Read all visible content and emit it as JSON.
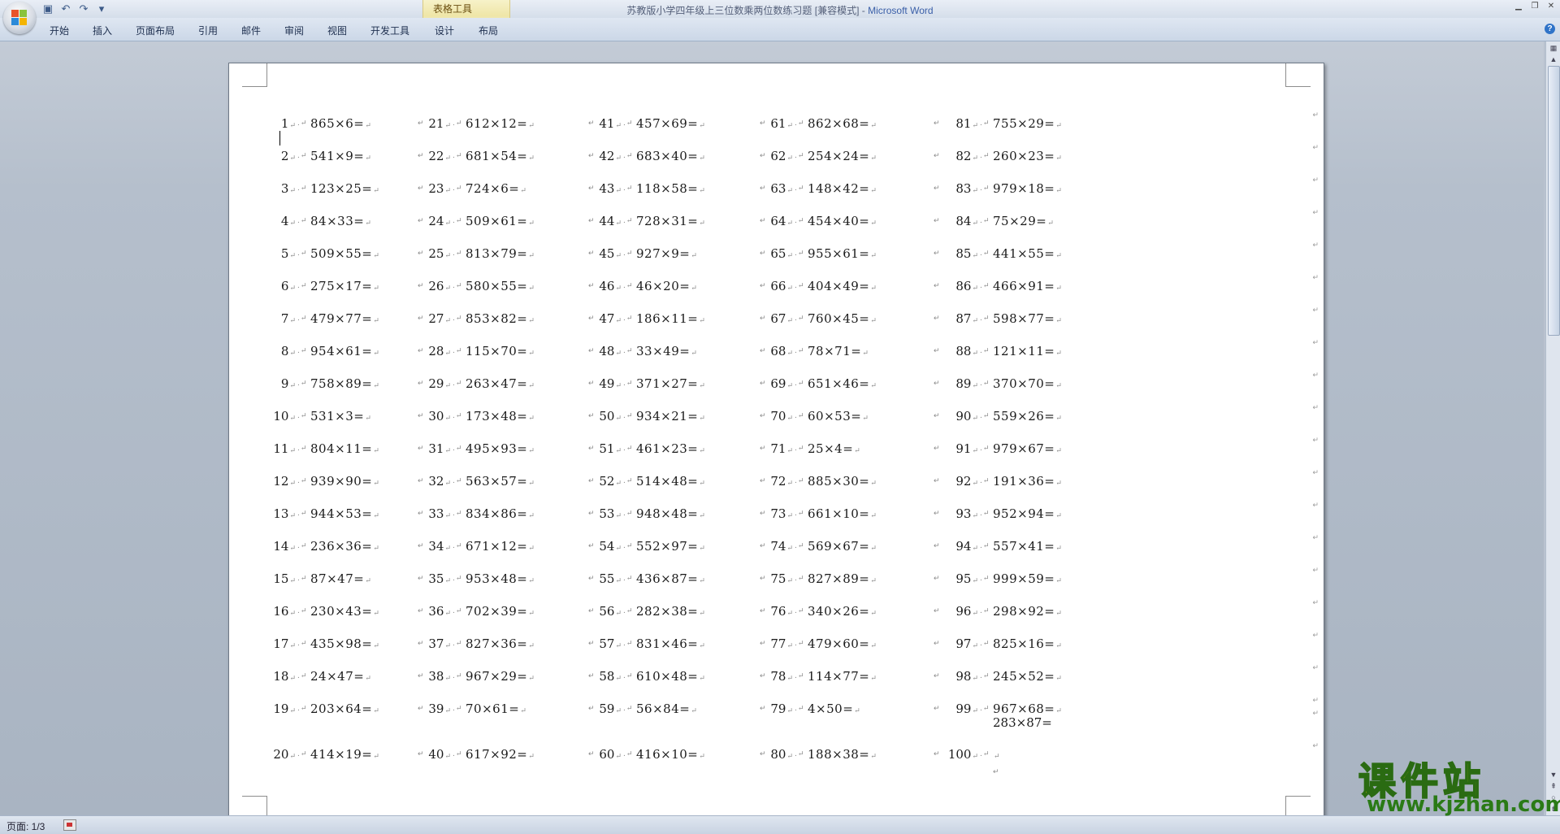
{
  "window": {
    "title": "苏教版小学四年级上三位数乘两位数练习题 [兼容模式] - ",
    "app_name": "Microsoft Word",
    "contextual_group": "表格工具"
  },
  "ribbon_tabs": [
    "开始",
    "插入",
    "页面布局",
    "引用",
    "邮件",
    "审阅",
    "视图",
    "开发工具",
    "设计",
    "布局"
  ],
  "status_bar": {
    "page": "页面: 1/3"
  },
  "watermark": {
    "main": "课件站",
    "sub": "www.kjzhan.com"
  },
  "document": {
    "columns": [
      [
        [
          "1",
          "865×6="
        ],
        [
          "2",
          "541×9="
        ],
        [
          "3",
          "123×25="
        ],
        [
          "4",
          "84×33="
        ],
        [
          "5",
          "509×55="
        ],
        [
          "6",
          "275×17="
        ],
        [
          "7",
          "479×77="
        ],
        [
          "8",
          "954×61="
        ],
        [
          "9",
          "758×89="
        ],
        [
          "10",
          "531×3="
        ],
        [
          "11",
          "804×11="
        ],
        [
          "12",
          "939×90="
        ],
        [
          "13",
          "944×53="
        ],
        [
          "14",
          "236×36="
        ],
        [
          "15",
          "87×47="
        ],
        [
          "16",
          "230×43="
        ],
        [
          "17",
          "435×98="
        ],
        [
          "18",
          "24×47="
        ],
        [
          "19",
          "203×64="
        ],
        [
          "20",
          "414×19="
        ]
      ],
      [
        [
          "21",
          "612×12="
        ],
        [
          "22",
          "681×54="
        ],
        [
          "23",
          "724×6="
        ],
        [
          "24",
          "509×61="
        ],
        [
          "25",
          "813×79="
        ],
        [
          "26",
          "580×55="
        ],
        [
          "27",
          "853×82="
        ],
        [
          "28",
          "115×70="
        ],
        [
          "29",
          "263×47="
        ],
        [
          "30",
          "173×48="
        ],
        [
          "31",
          "495×93="
        ],
        [
          "32",
          "563×57="
        ],
        [
          "33",
          "834×86="
        ],
        [
          "34",
          "671×12="
        ],
        [
          "35",
          "953×48="
        ],
        [
          "36",
          "702×39="
        ],
        [
          "37",
          "827×36="
        ],
        [
          "38",
          "967×29="
        ],
        [
          "39",
          "70×61="
        ],
        [
          "40",
          "617×92="
        ]
      ],
      [
        [
          "41",
          "457×69="
        ],
        [
          "42",
          "683×40="
        ],
        [
          "43",
          "118×58="
        ],
        [
          "44",
          "728×31="
        ],
        [
          "45",
          "927×9="
        ],
        [
          "46",
          "46×20="
        ],
        [
          "47",
          "186×11="
        ],
        [
          "48",
          "33×49="
        ],
        [
          "49",
          "371×27="
        ],
        [
          "50",
          "934×21="
        ],
        [
          "51",
          "461×23="
        ],
        [
          "52",
          "514×48="
        ],
        [
          "53",
          "948×48="
        ],
        [
          "54",
          "552×97="
        ],
        [
          "55",
          "436×87="
        ],
        [
          "56",
          "282×38="
        ],
        [
          "57",
          "831×46="
        ],
        [
          "58",
          "610×48="
        ],
        [
          "59",
          "56×84="
        ],
        [
          "60",
          "416×10="
        ]
      ],
      [
        [
          "61",
          "862×68="
        ],
        [
          "62",
          "254×24="
        ],
        [
          "63",
          "148×42="
        ],
        [
          "64",
          "454×40="
        ],
        [
          "65",
          "955×61="
        ],
        [
          "66",
          "404×49="
        ],
        [
          "67",
          "760×45="
        ],
        [
          "68",
          "78×71="
        ],
        [
          "69",
          "651×46="
        ],
        [
          "70",
          "60×53="
        ],
        [
          "71",
          "25×4="
        ],
        [
          "72",
          "885×30="
        ],
        [
          "73",
          "661×10="
        ],
        [
          "74",
          "569×67="
        ],
        [
          "75",
          "827×89="
        ],
        [
          "76",
          "340×26="
        ],
        [
          "77",
          "479×60="
        ],
        [
          "78",
          "114×77="
        ],
        [
          "79",
          "4×50="
        ],
        [
          "80",
          "188×38="
        ]
      ],
      [
        [
          "81",
          "755×29="
        ],
        [
          "82",
          "260×23="
        ],
        [
          "83",
          "979×18="
        ],
        [
          "84",
          "75×29="
        ],
        [
          "85",
          "441×55="
        ],
        [
          "86",
          "466×91="
        ],
        [
          "87",
          "598×77="
        ],
        [
          "88",
          "121×11="
        ],
        [
          "89",
          "370×70="
        ],
        [
          "90",
          "559×26="
        ],
        [
          "91",
          "979×67="
        ],
        [
          "92",
          "191×36="
        ],
        [
          "93",
          "952×94="
        ],
        [
          "94",
          "557×41="
        ],
        [
          "95",
          "999×59="
        ],
        [
          "96",
          "298×92="
        ],
        [
          "97",
          "825×16="
        ],
        [
          "98",
          "245×52="
        ],
        [
          "99",
          "967×68="
        ],
        [
          "100",
          ""
        ]
      ]
    ],
    "extra_expression": "283×87=",
    "mark": "↵",
    "dot": "."
  }
}
